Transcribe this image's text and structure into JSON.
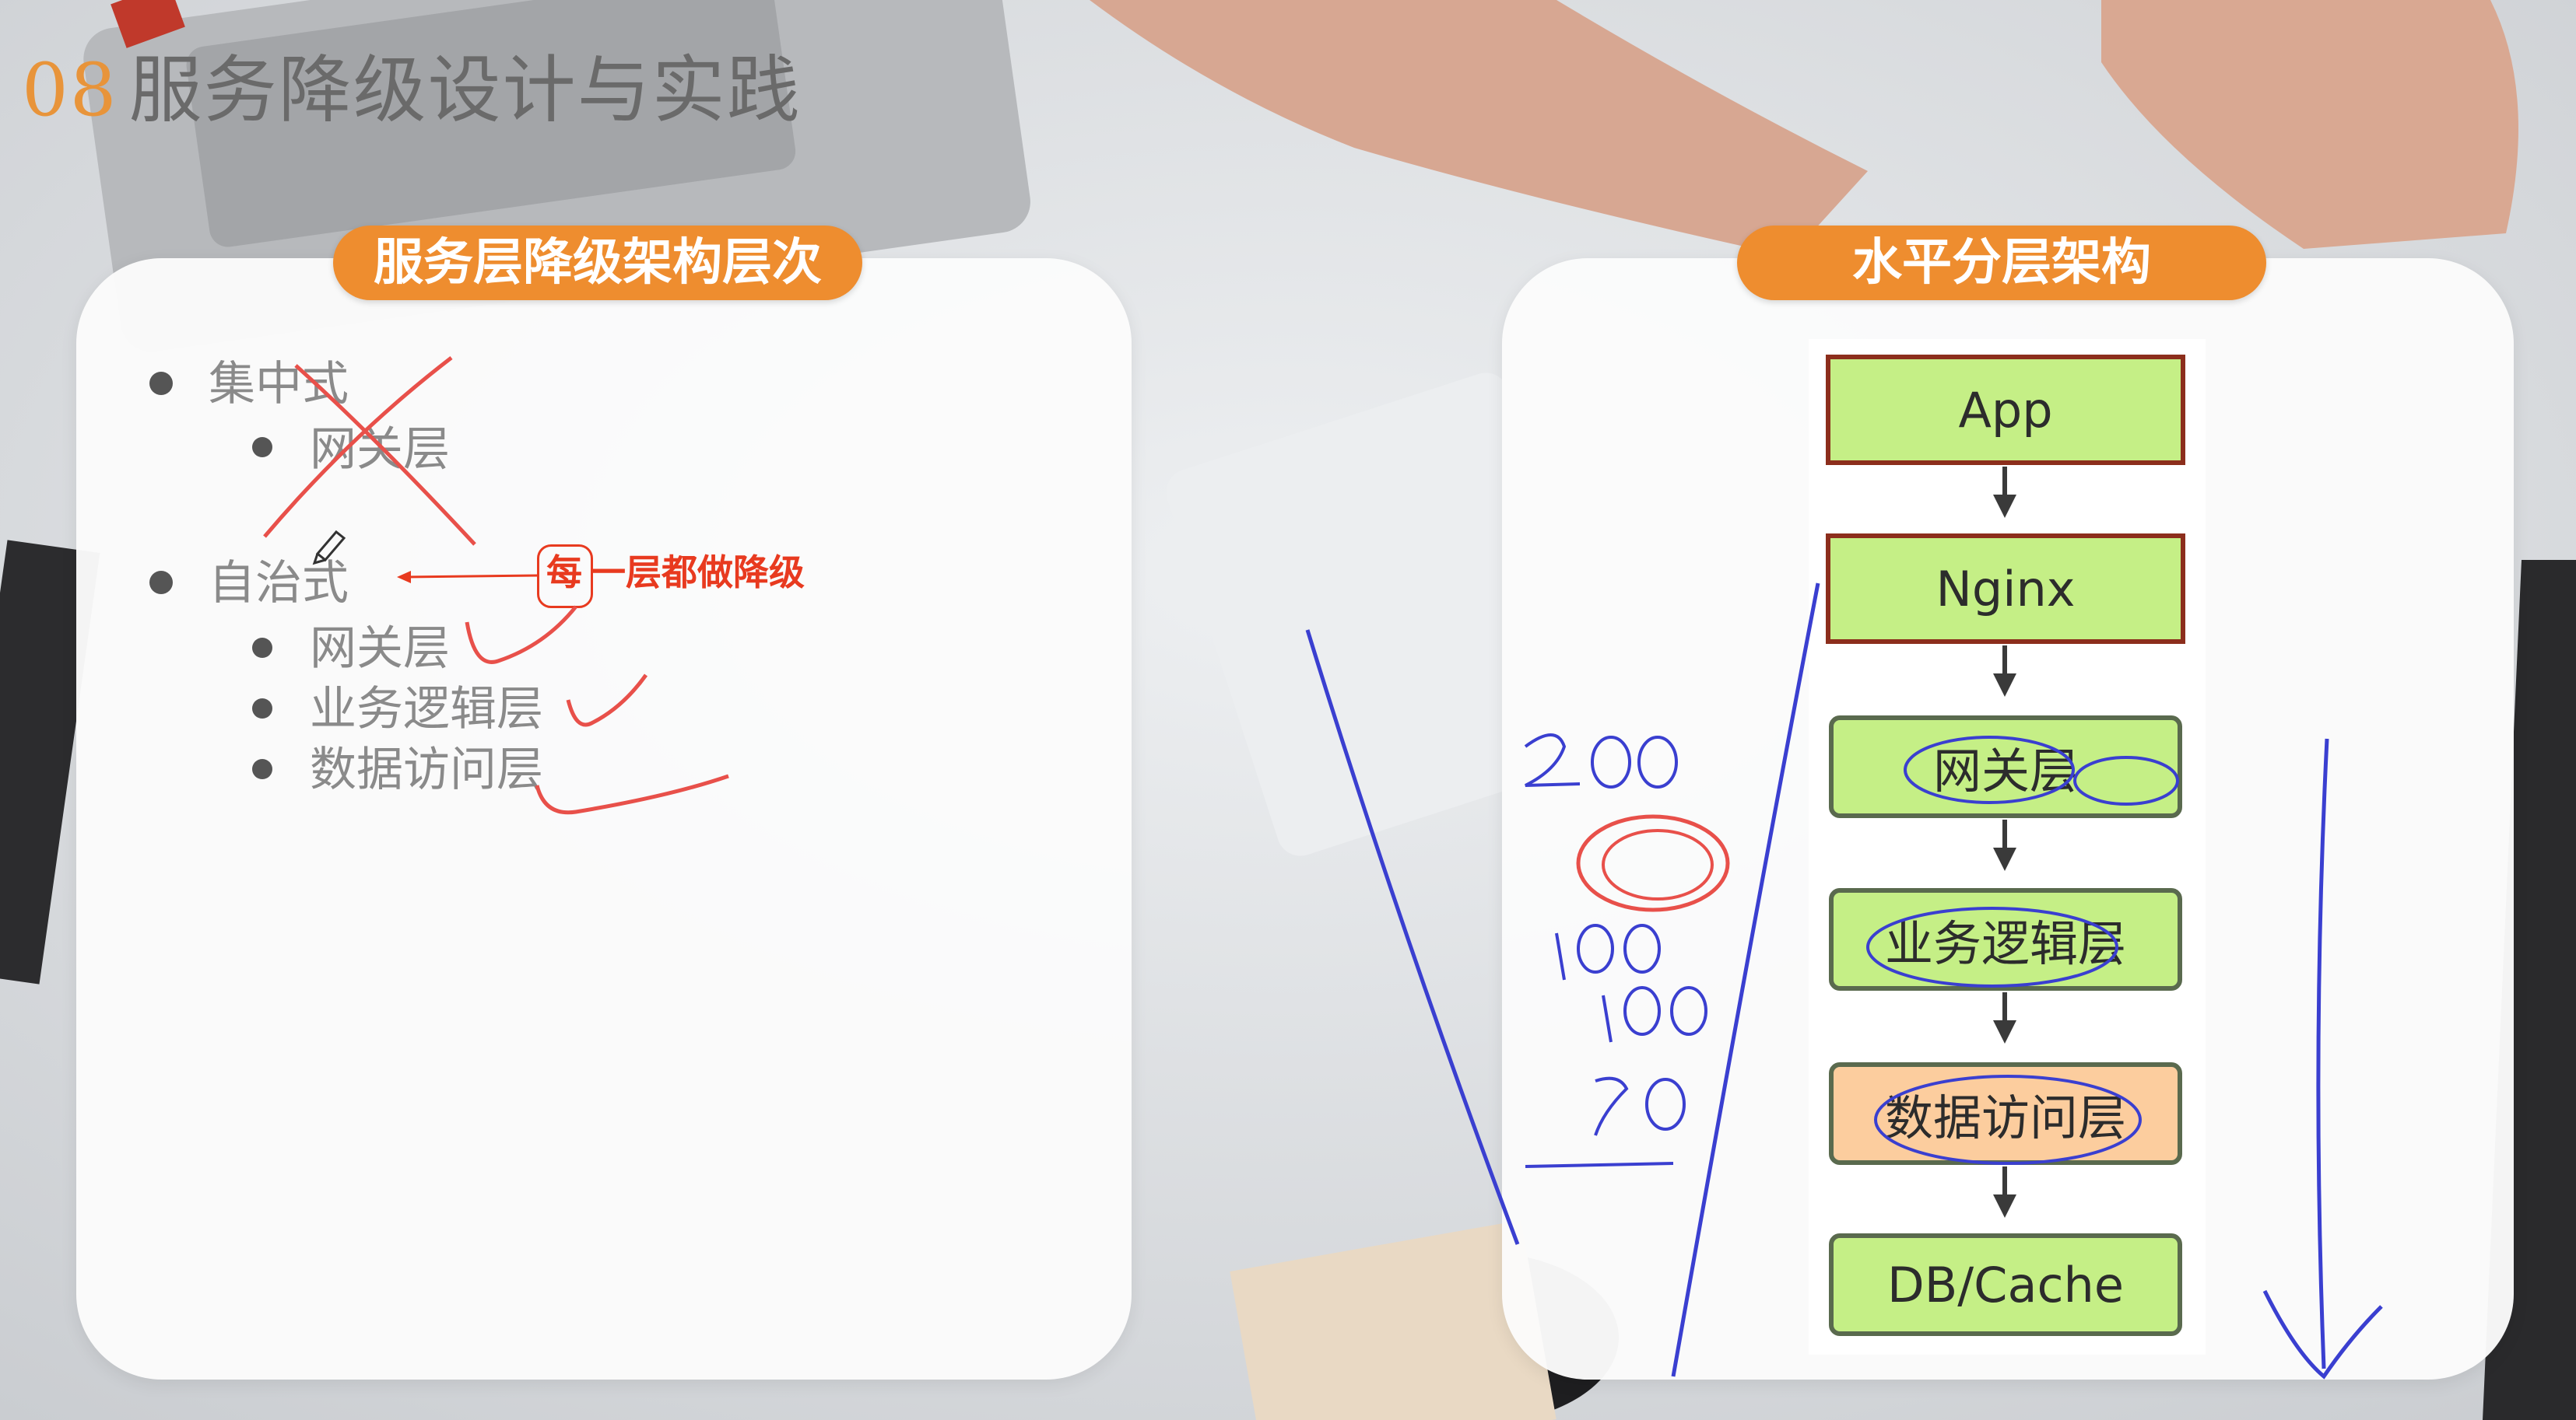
{
  "slide": {
    "number": "08",
    "title": "服务降级设计与实践"
  },
  "left_panel": {
    "heading": "服务层降级架构层次",
    "items": [
      {
        "label": "集中式",
        "children": [
          "网关层"
        ]
      },
      {
        "label": "自治式",
        "children": [
          "网关层",
          "业务逻辑层",
          "数据访问层"
        ]
      }
    ],
    "annotation": {
      "highlight": "每",
      "rest": "一层都做降级"
    }
  },
  "right_panel": {
    "heading": "水平分层架构",
    "layers": [
      "App",
      "Nginx",
      "网关层",
      "业务逻辑层",
      "数据访问层",
      "DB/Cache"
    ]
  },
  "colors": {
    "accent_orange": "#ee8d2f",
    "layer_green": "#c5ef86",
    "layer_orange": "#fccd9e",
    "ink_red": "#e83a1f",
    "ink_blue": "#3a3fd0"
  },
  "icons": [
    "pencil-cursor-icon",
    "arrow-left-icon",
    "arrow-down-icon"
  ]
}
